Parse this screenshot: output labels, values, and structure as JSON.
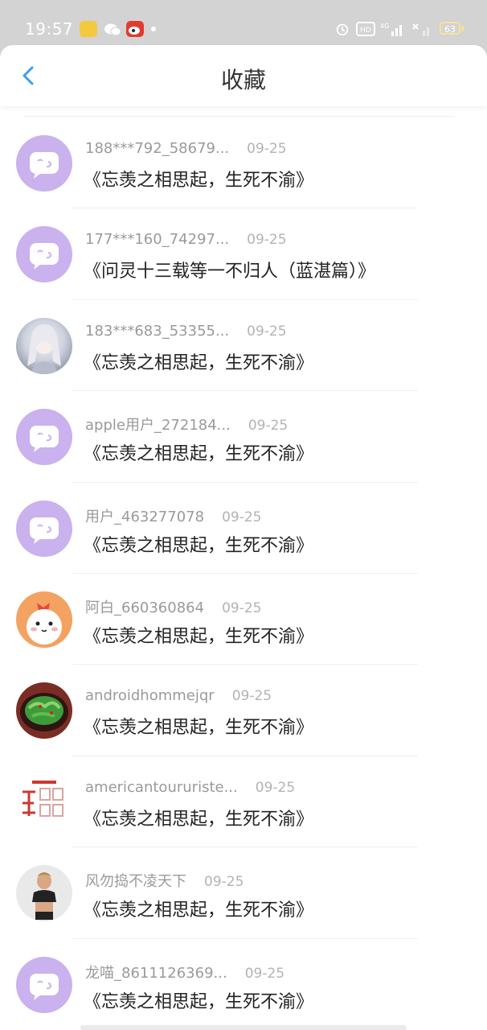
{
  "status_bar": {
    "time": "19:57",
    "battery": "63",
    "icons": [
      "alarm-icon",
      "hd-icon",
      "signal-4g-icon",
      "signal-icon",
      "wifi-off-icon"
    ]
  },
  "nav": {
    "title": "收藏",
    "back_icon": "chevron-left-icon",
    "accent": "#3d9cf0"
  },
  "favorites": [
    {
      "user": "188***792_58679...",
      "date": "09-25",
      "title": "《忘羡之相思起，生死不渝》",
      "avatar": "default"
    },
    {
      "user": "177***160_74297...",
      "date": "09-25",
      "title": "《问灵十三载等一不归人（蓝湛篇）》",
      "avatar": "default"
    },
    {
      "user": "183***683_53355...",
      "date": "09-25",
      "title": "《忘羡之相思起，生死不渝》",
      "avatar": "photo-girl"
    },
    {
      "user": "apple用户_272184...",
      "date": "09-25",
      "title": "《忘羡之相思起，生死不渝》",
      "avatar": "default"
    },
    {
      "user": "用户_463277078",
      "date": "09-25",
      "title": "《忘羡之相思起，生死不渝》",
      "avatar": "default"
    },
    {
      "user": "阿白_660360864",
      "date": "09-25",
      "title": "《忘羡之相思起，生死不渝》",
      "avatar": "cartoon-face"
    },
    {
      "user": "androidhommejqr",
      "date": "09-25",
      "title": "《忘羡之相思起，生死不渝》",
      "avatar": "food-photo"
    },
    {
      "user": "americantoururiste...",
      "date": "09-25",
      "title": "《忘羡之相思起，生死不渝》",
      "avatar": "calligraphy"
    },
    {
      "user": "风勿捣不凌天下",
      "date": "09-25",
      "title": "《忘羡之相思起，生死不渝》",
      "avatar": "sport-photo"
    },
    {
      "user": "龙喵_8611126369...",
      "date": "09-25",
      "title": "《忘羡之相思起，生死不渝》",
      "avatar": "default"
    }
  ]
}
